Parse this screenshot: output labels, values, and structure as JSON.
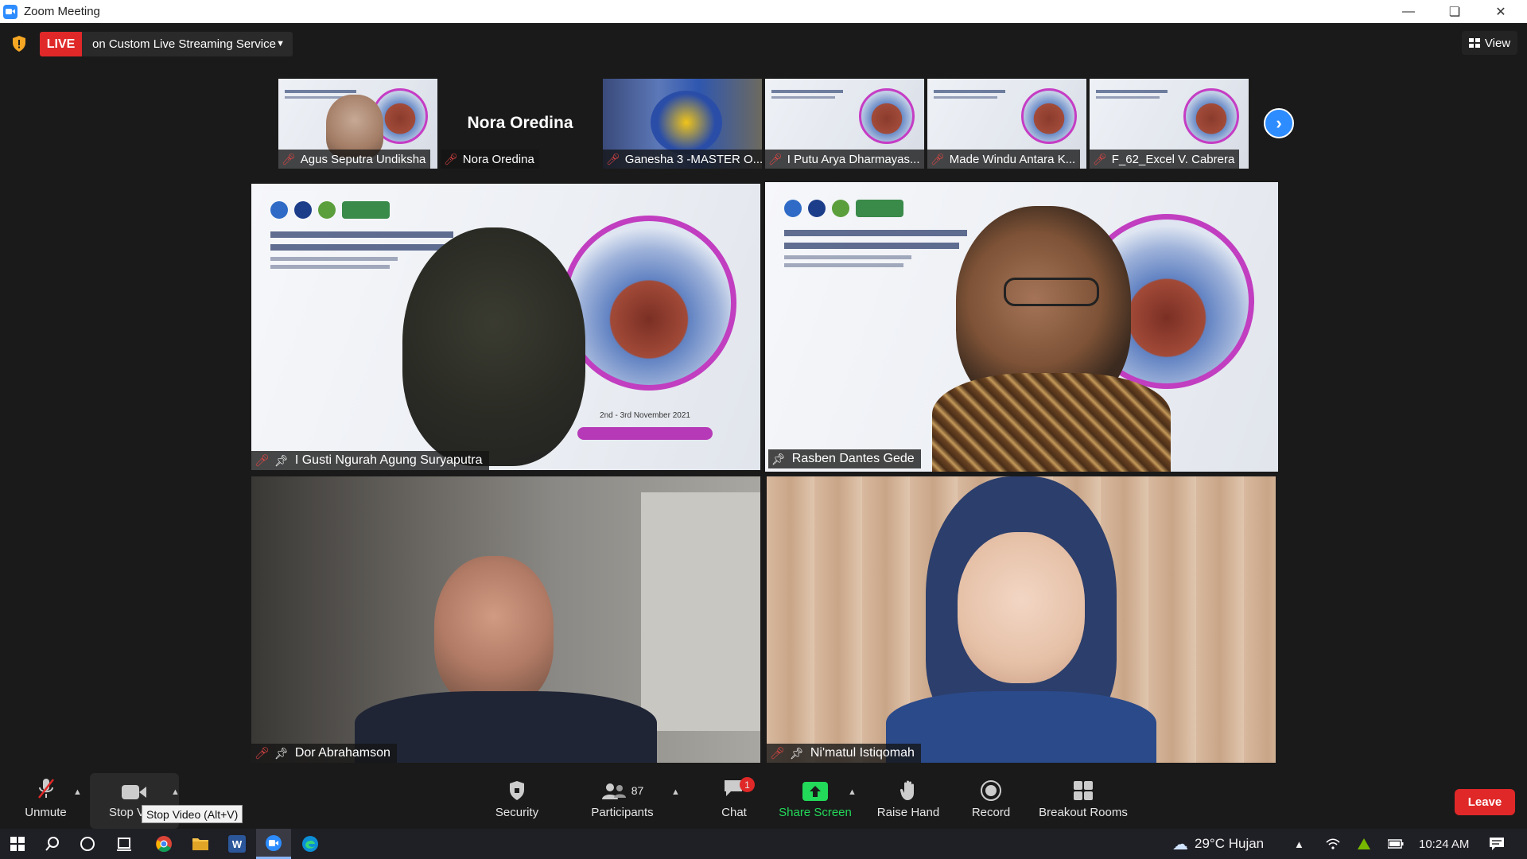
{
  "window": {
    "title": "Zoom Meeting"
  },
  "topbar": {
    "live_label": "LIVE",
    "live_service": "on Custom Live Streaming Service",
    "view_label": "View"
  },
  "thumbnails": [
    {
      "name": "Agus Seputra Undiksha",
      "muted": true,
      "type": "video"
    },
    {
      "name": "Nora Oredina",
      "display_name": "Nora Oredina",
      "muted": true,
      "type": "name-only"
    },
    {
      "name": "Ganesha 3 -MASTER O...",
      "muted": true,
      "type": "video"
    },
    {
      "name": "I Putu Arya Dharmayas...",
      "muted": true,
      "type": "video"
    },
    {
      "name": "Made Windu Antara K...",
      "muted": true,
      "type": "video"
    },
    {
      "name": "F_62_Excel V. Cabrera",
      "muted": true,
      "type": "video"
    }
  ],
  "tiles": [
    {
      "name": "I Gusti Ngurah Agung Suryaputra",
      "muted": true,
      "active": false,
      "date_text": "2nd - 3rd November 2021"
    },
    {
      "name": "Rasben Dantes Gede",
      "muted": false,
      "active": true
    },
    {
      "name": "Dor Abrahamson",
      "muted": true,
      "active": false
    },
    {
      "name": "Ni'matul Istiqomah",
      "muted": true,
      "active": false
    }
  ],
  "controls": {
    "unmute": "Unmute",
    "stop_video": "Stop Video",
    "stop_video_tooltip": "Stop Video (Alt+V)",
    "security": "Security",
    "participants": "Participants",
    "participants_count": "87",
    "chat": "Chat",
    "chat_badge": "1",
    "share_screen": "Share Screen",
    "raise_hand": "Raise Hand",
    "record": "Record",
    "breakout_rooms": "Breakout Rooms",
    "leave": "Leave"
  },
  "taskbar": {
    "weather": "29°C  Hujan",
    "time": "10:24 AM"
  },
  "colors": {
    "live_red": "#e02828",
    "zoom_blue": "#2d8cff",
    "active_speaker": "#c6e34b",
    "share_green": "#23d959"
  }
}
